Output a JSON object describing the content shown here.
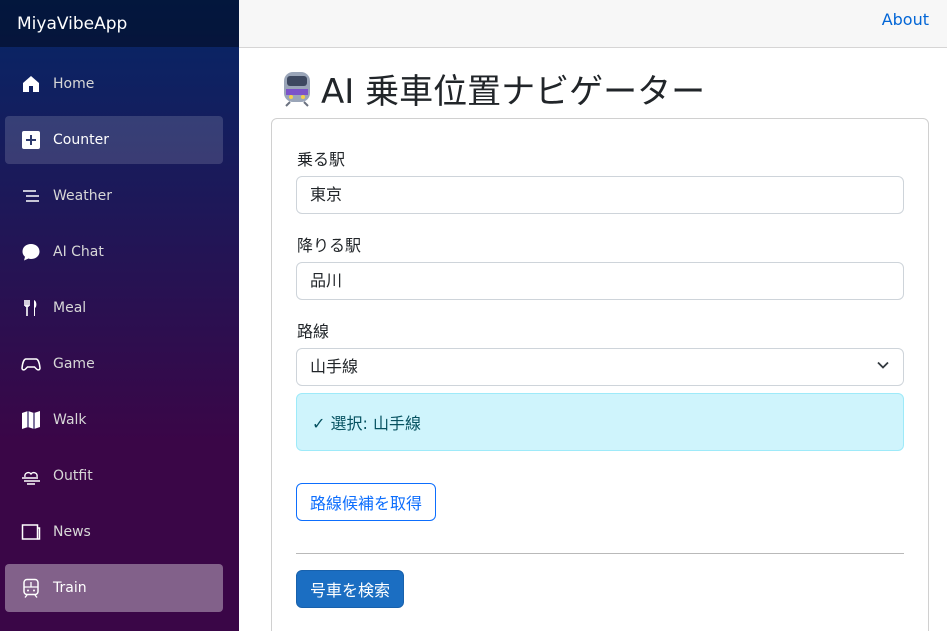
{
  "app": {
    "brand": "MiyaVibeApp"
  },
  "sidebar": {
    "items": [
      {
        "label": "Home",
        "icon": "home-icon"
      },
      {
        "label": "Counter",
        "icon": "plus-icon"
      },
      {
        "label": "Weather",
        "icon": "list-icon"
      },
      {
        "label": "AI Chat",
        "icon": "chat-icon"
      },
      {
        "label": "Meal",
        "icon": "utensils-icon"
      },
      {
        "label": "Game",
        "icon": "controller-icon"
      },
      {
        "label": "Walk",
        "icon": "map-icon"
      },
      {
        "label": "Outfit",
        "icon": "cloud-wind-icon"
      },
      {
        "label": "News",
        "icon": "newspaper-icon"
      },
      {
        "label": "Train",
        "icon": "train-icon"
      }
    ]
  },
  "topbar": {
    "about_label": "About"
  },
  "page": {
    "title": "AI 乗車位置ナビゲーター",
    "title_icon": "train-emoji"
  },
  "form": {
    "from_label": "乗る駅",
    "from_value": "東京",
    "to_label": "降りる駅",
    "to_value": "品川",
    "line_label": "路線",
    "line_value": "山手線",
    "selected_text": "✓ 選択: 山手線",
    "fetch_lines_label": "路線候補を取得",
    "search_label": "号車を検索"
  },
  "colors": {
    "link": "#0366d6",
    "primary": "#1b6ec2",
    "info_bg": "#cff4fc"
  }
}
